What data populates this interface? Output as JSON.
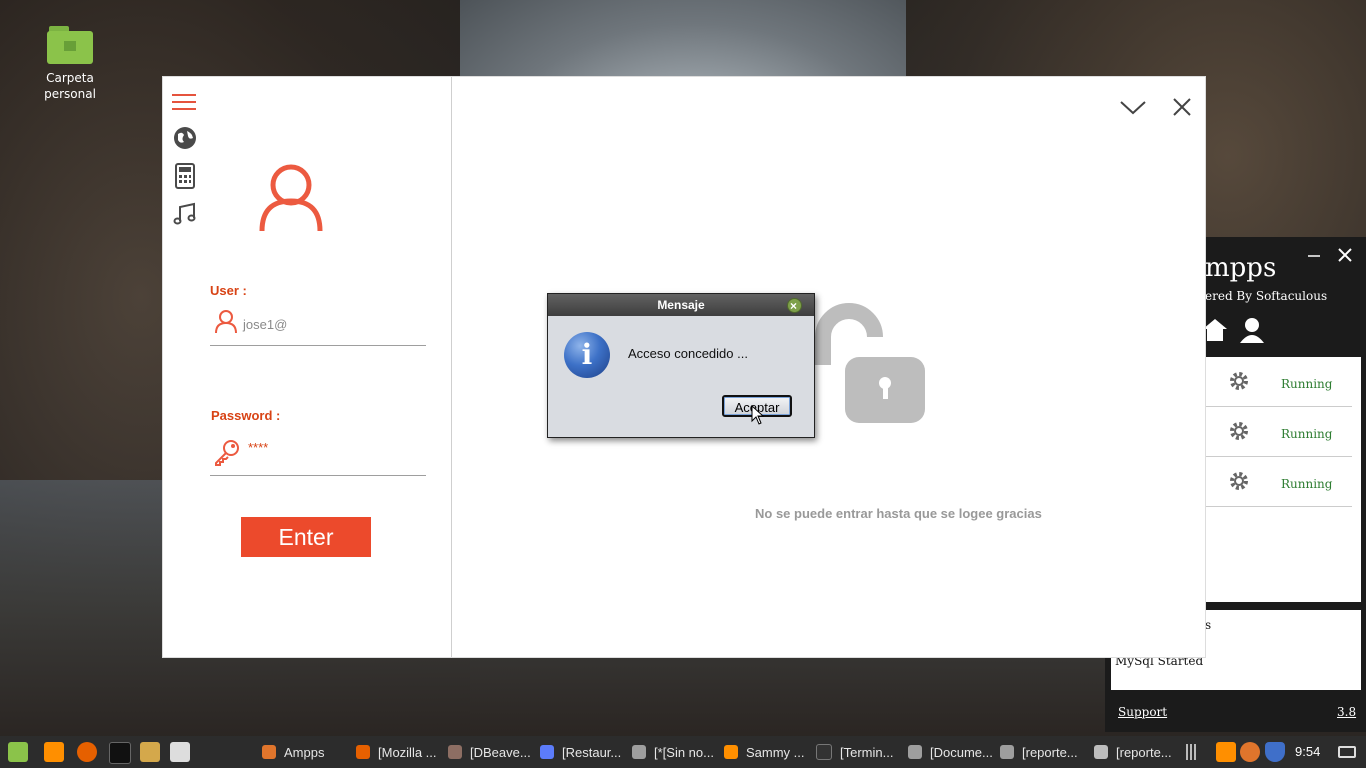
{
  "desktop": {
    "home_icon_label": "Carpeta personal"
  },
  "login": {
    "user_label": "User :",
    "user_value": "jose1@",
    "password_label": "Password :",
    "password_value": "****",
    "enter_button": "Enter"
  },
  "main": {
    "locked_message": "No se puede entrar hasta que se logee gracias"
  },
  "dialog": {
    "title": "Mensaje",
    "message": "Acceso concedido ...",
    "ok_button": "Aceptar"
  },
  "ampps": {
    "title": "mpps",
    "subtitle": "ered By Softaculous",
    "services": [
      {
        "status": "Running"
      },
      {
        "status": "Running"
      },
      {
        "status": "Running"
      }
    ],
    "log_line1": "s",
    "log_line2": "MySql Started",
    "support_link": "Support",
    "version": "3.8"
  },
  "taskbar": {
    "items": [
      {
        "label": "Ampps",
        "color": "#e0752c"
      },
      {
        "label": "[Mozilla ...",
        "color": "#e66000"
      },
      {
        "label": "[DBeave...",
        "color": "#8d6e63"
      },
      {
        "label": "[Restaur...",
        "color": "#5c7cfa"
      },
      {
        "label": "[*[Sin no...",
        "color": "#9e9e9e"
      },
      {
        "label": "Sammy ...",
        "color": "#ff8f00"
      },
      {
        "label": "[Termin...",
        "color": "#333333"
      },
      {
        "label": "[Docume...",
        "color": "#9e9e9e"
      },
      {
        "label": "[reporte...",
        "color": "#9e9e9e"
      },
      {
        "label": "[reporte...",
        "color": "#bdbdbd"
      }
    ],
    "clock": "9:54"
  },
  "colors": {
    "accent": "#ec4a2c",
    "running": "#2e7d32"
  }
}
